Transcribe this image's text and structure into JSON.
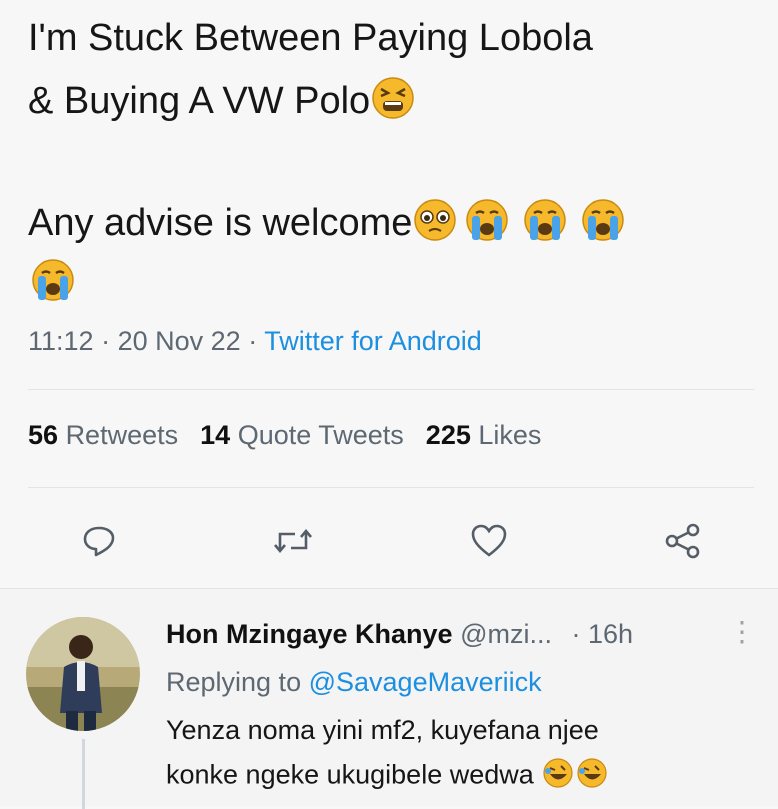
{
  "tweet": {
    "line1": "I'm Stuck Between Paying Lobola",
    "line2": "& Buying A VW Polo",
    "line3": "Any advise is welcome",
    "time": "11:12",
    "date": "20 Nov 22",
    "source": "Twitter for Android",
    "separator": "·"
  },
  "stats": {
    "retweets_count": "56",
    "retweets_label": "Retweets",
    "quotes_count": "14",
    "quotes_label": "Quote Tweets",
    "likes_count": "225",
    "likes_label": "Likes"
  },
  "actions": [
    "reply-icon",
    "retweet-icon",
    "like-icon",
    "share-icon"
  ],
  "reply": {
    "name": "Hon Mzingaye Khanye",
    "handle": "@mzi...",
    "age": "· 16h",
    "more": "⋮",
    "replying_prefix": "Replying to",
    "replying_handle": "@SavageMaveriick",
    "line1": "Yenza noma yini mf2, kuyefana njee",
    "line2": "konke ngeke ukugibele wedwa"
  },
  "colors": {
    "link": "#1d8fe0",
    "secondary_text": "#5d6872",
    "emoji_face": "#f5b92b",
    "tears": "#4aa3e8"
  }
}
